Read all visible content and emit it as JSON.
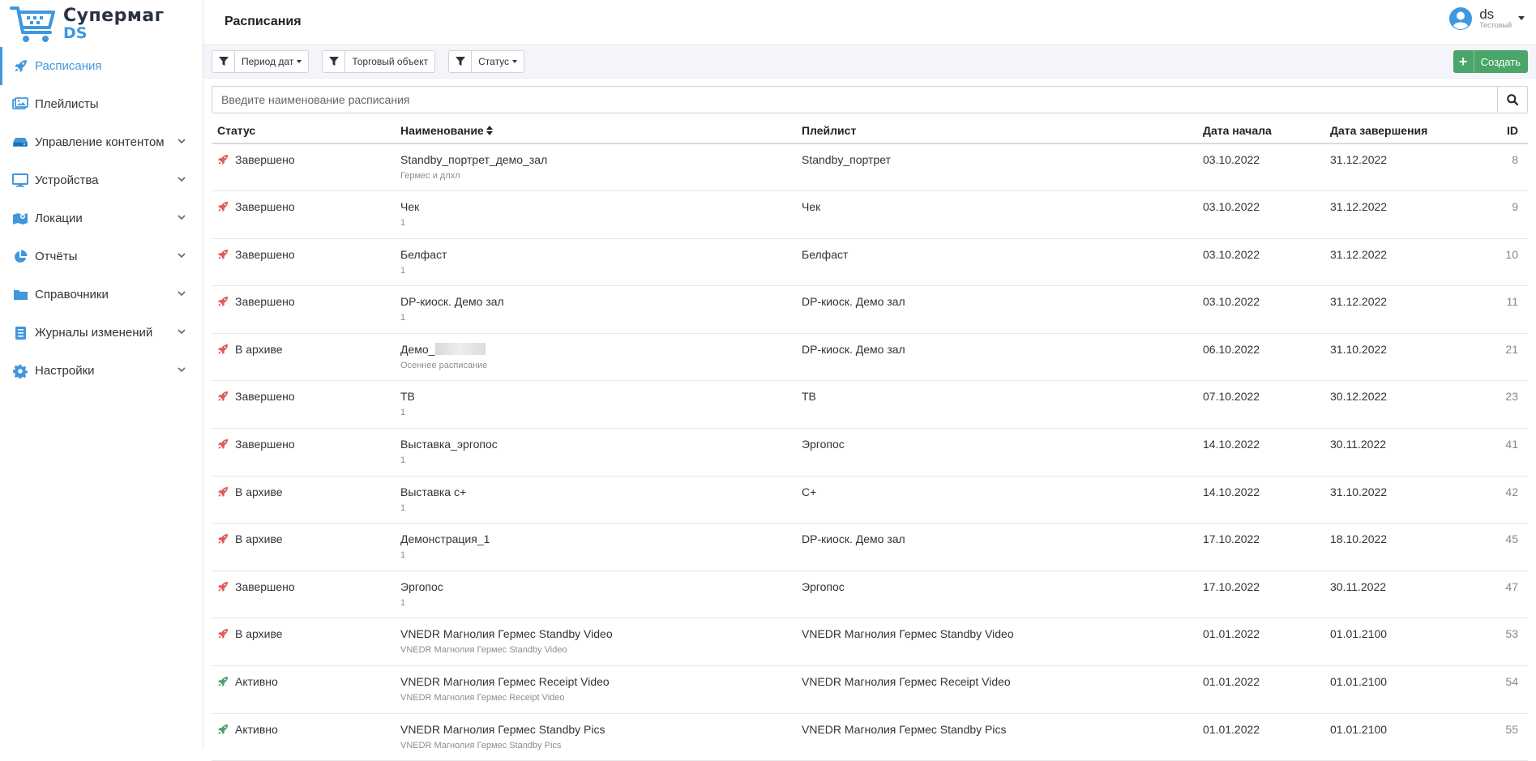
{
  "logo": {
    "line1": "Супермаг",
    "line2": "DS"
  },
  "nav": [
    {
      "label": "Расписания",
      "icon": "rocket-icon",
      "active": true,
      "expandable": false
    },
    {
      "label": "Плейлисты",
      "icon": "images-icon",
      "active": false,
      "expandable": false
    },
    {
      "label": "Управление контентом",
      "icon": "hdd-icon",
      "active": false,
      "expandable": true
    },
    {
      "label": "Устройства",
      "icon": "monitor-icon",
      "active": false,
      "expandable": true
    },
    {
      "label": "Локации",
      "icon": "map-marker-icon",
      "active": false,
      "expandable": true
    },
    {
      "label": "Отчёты",
      "icon": "pie-chart-icon",
      "active": false,
      "expandable": true
    },
    {
      "label": "Справочники",
      "icon": "folder-icon",
      "active": false,
      "expandable": true
    },
    {
      "label": "Журналы изменений",
      "icon": "journal-icon",
      "active": false,
      "expandable": true
    },
    {
      "label": "Настройки",
      "icon": "gear-icon",
      "active": false,
      "expandable": true
    }
  ],
  "header": {
    "title": "Расписания"
  },
  "user": {
    "name": "ds",
    "role": "Тестовый"
  },
  "filters": [
    {
      "label": "Период дат",
      "has_caret": true
    },
    {
      "label": "Торговый объект",
      "has_caret": false
    },
    {
      "label": "Статус",
      "has_caret": true
    }
  ],
  "create_label": "Создать",
  "search": {
    "placeholder": "Введите наименование расписания",
    "value": ""
  },
  "table": {
    "columns": [
      "Статус",
      "Наименование",
      "Плейлист",
      "Дата начала",
      "Дата завершения",
      "ID"
    ],
    "rows": [
      {
        "status": "Завершено",
        "state": "done",
        "name": "Standby_портрет_демо_зал",
        "sub": "Гермес и длхл",
        "playlist": "Standby_портрет",
        "start": "03.10.2022",
        "end": "31.12.2022",
        "id": "8"
      },
      {
        "status": "Завершено",
        "state": "done",
        "name": "Чек",
        "sub": "1",
        "playlist": "Чек",
        "start": "03.10.2022",
        "end": "31.12.2022",
        "id": "9"
      },
      {
        "status": "Завершено",
        "state": "done",
        "name": "Белфаст",
        "sub": "1",
        "playlist": "Белфаст",
        "start": "03.10.2022",
        "end": "31.12.2022",
        "id": "10"
      },
      {
        "status": "Завершено",
        "state": "done",
        "name": "DP-киоск. Демо зал",
        "sub": "1",
        "playlist": "DP-киоск. Демо зал",
        "start": "03.10.2022",
        "end": "31.12.2022",
        "id": "11"
      },
      {
        "status": "В архиве",
        "state": "archived",
        "name": "Демо_",
        "redacted": true,
        "sub": "Осеннее расписание",
        "playlist": "DP-киоск. Демо зал",
        "start": "06.10.2022",
        "end": "31.10.2022",
        "id": "21"
      },
      {
        "status": "Завершено",
        "state": "done",
        "name": "ТВ",
        "sub": "1",
        "playlist": "ТВ",
        "start": "07.10.2022",
        "end": "30.12.2022",
        "id": "23"
      },
      {
        "status": "Завершено",
        "state": "done",
        "name": "Выставка_эргопос",
        "sub": "1",
        "playlist": "Эргопос",
        "start": "14.10.2022",
        "end": "30.11.2022",
        "id": "41"
      },
      {
        "status": "В архиве",
        "state": "archived",
        "name": "Выставка с+",
        "sub": "1",
        "playlist": "С+",
        "start": "14.10.2022",
        "end": "31.10.2022",
        "id": "42"
      },
      {
        "status": "В архиве",
        "state": "archived",
        "name": "Демонстрация_1",
        "sub": "1",
        "playlist": "DP-киоск. Демо зал",
        "start": "17.10.2022",
        "end": "18.10.2022",
        "id": "45"
      },
      {
        "status": "Завершено",
        "state": "done",
        "name": "Эргопос",
        "sub": "1",
        "playlist": "Эргопос",
        "start": "17.10.2022",
        "end": "30.11.2022",
        "id": "47"
      },
      {
        "status": "В архиве",
        "state": "archived",
        "name": "VNEDR Магнолия Гермес Standby Video",
        "sub": "VNEDR Магнолия Гермес Standby Video",
        "playlist": "VNEDR Магнолия Гермес Standby Video",
        "start": "01.01.2022",
        "end": "01.01.2100",
        "id": "53"
      },
      {
        "status": "Активно",
        "state": "active",
        "name": "VNEDR Магнолия Гермес Receipt Video",
        "sub": "VNEDR Магнолия Гермес Receipt Video",
        "playlist": "VNEDR Магнолия Гермес Receipt Video",
        "start": "01.01.2022",
        "end": "01.01.2100",
        "id": "54"
      },
      {
        "status": "Активно",
        "state": "active",
        "name": "VNEDR Магнолия Гермес Standby Pics",
        "sub": "VNEDR Магнолия Гермес Standby Pics",
        "playlist": "VNEDR Магнолия Гермес Standby Pics",
        "start": "01.01.2022",
        "end": "01.01.2100",
        "id": "55"
      }
    ]
  },
  "colors": {
    "accent": "#3f97de",
    "rocket_done": "#e05b5b",
    "rocket_active": "#4aa569",
    "create": "#4aa569"
  }
}
